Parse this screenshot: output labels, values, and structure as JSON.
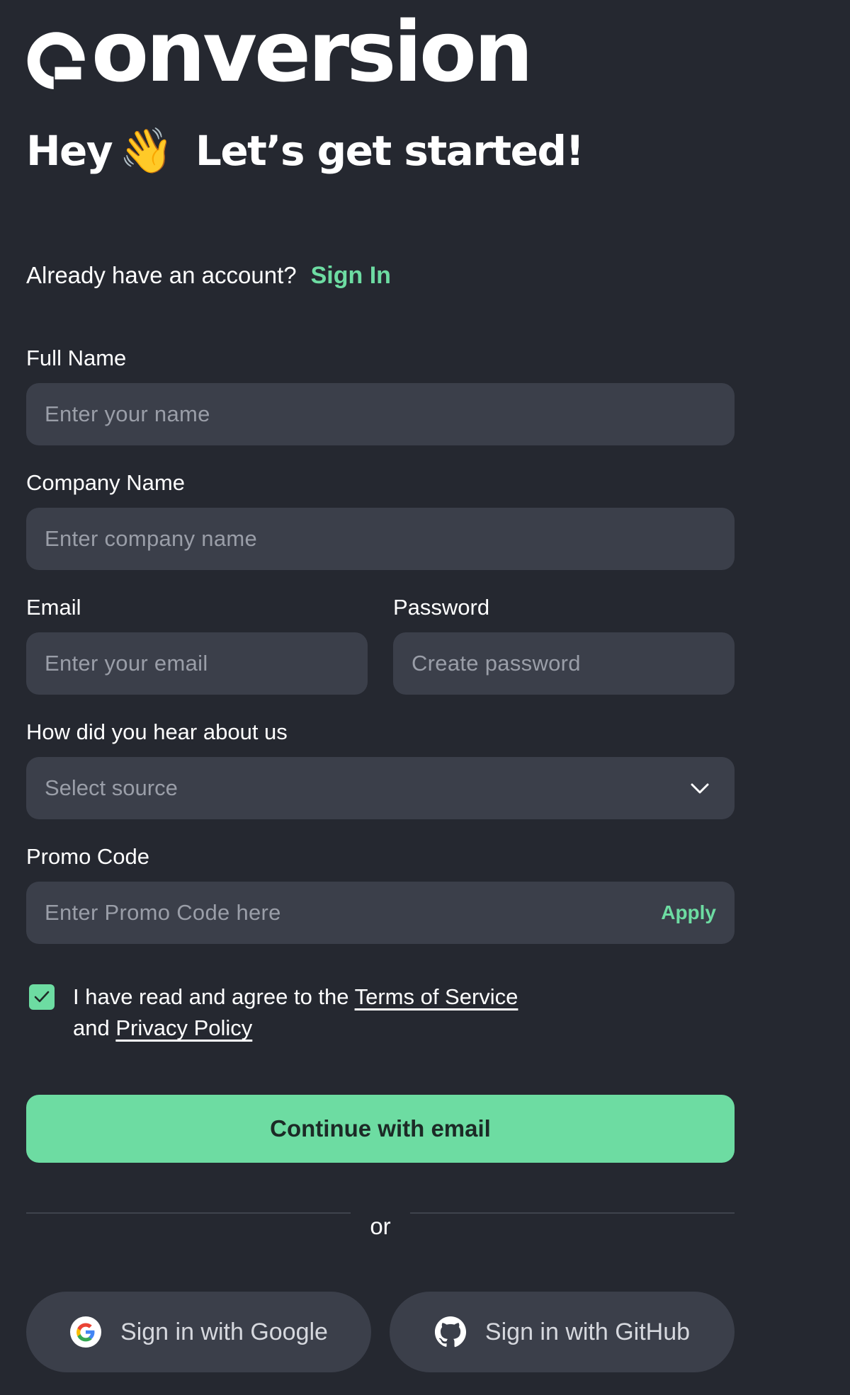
{
  "brand": {
    "name": "onversion",
    "accent": "#6ddca2",
    "background": "#252830",
    "field_bg": "#3b3f4a"
  },
  "header": {
    "greeting": "Hey",
    "wave_emoji": "👋",
    "headline": "Let’s get started!"
  },
  "signin": {
    "prompt": "Already have an account?",
    "link": "Sign In"
  },
  "form": {
    "full_name": {
      "label": "Full Name",
      "placeholder": "Enter your name",
      "value": ""
    },
    "company": {
      "label": "Company Name",
      "placeholder": "Enter company name",
      "value": ""
    },
    "email": {
      "label": "Email",
      "placeholder": "Enter your email",
      "value": ""
    },
    "password": {
      "label": "Password",
      "placeholder": "Create password",
      "value": ""
    },
    "source": {
      "label": "How did you hear about us",
      "selected": "Select source",
      "icon": "chevron-down-icon"
    },
    "promo": {
      "label": "Promo Code",
      "placeholder": "Enter Promo Code here",
      "apply": "Apply",
      "value": ""
    }
  },
  "agreement": {
    "checked": true,
    "text_before": "I have read and agree to the ",
    "terms": "Terms of Service",
    "text_and": "and ",
    "privacy": "Privacy Policy"
  },
  "actions": {
    "continue": "Continue with email",
    "or": "or",
    "google": "Sign in with Google",
    "github": "Sign in with GitHub"
  }
}
